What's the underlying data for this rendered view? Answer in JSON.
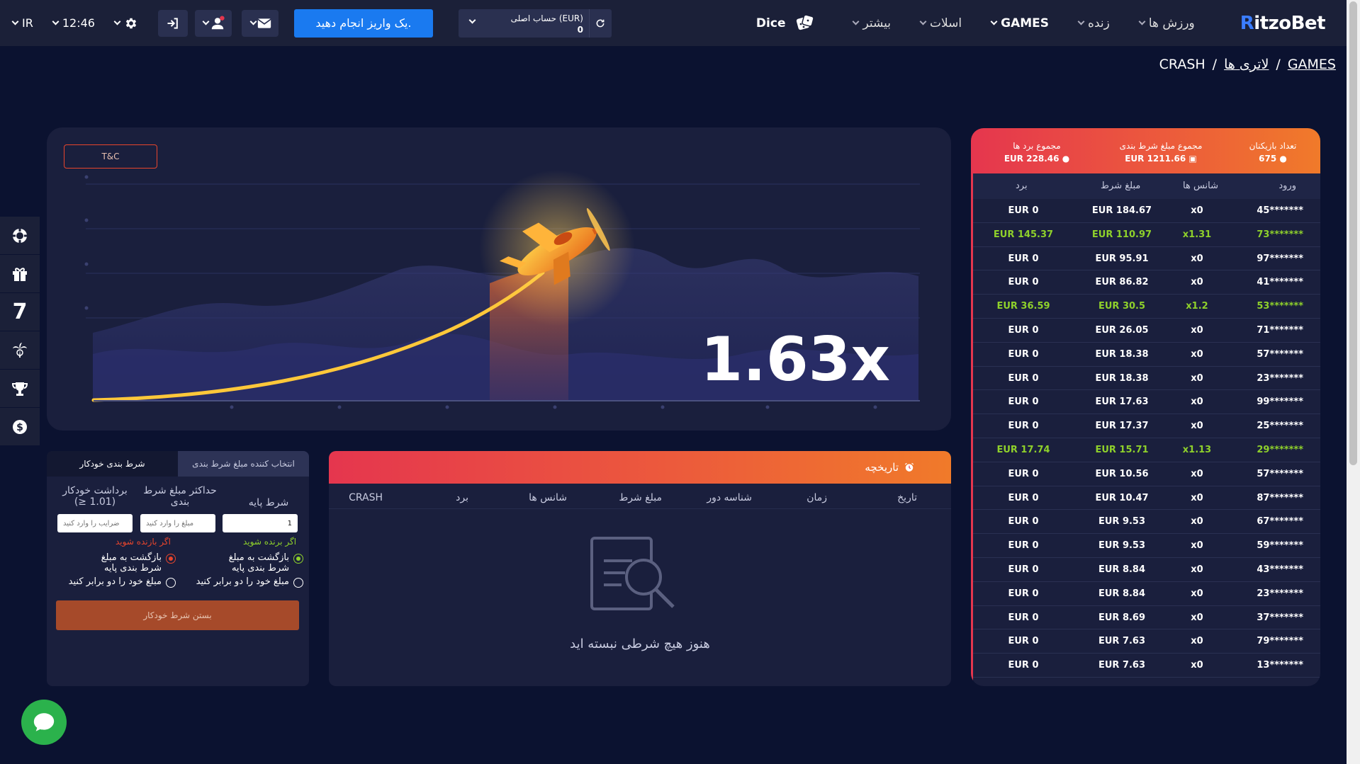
{
  "topbar": {
    "lang": "IR",
    "time": "12:46",
    "deposit_label": "یک واریز انجام دهید.",
    "account_label": "حساب اصلی (EUR)",
    "account_value": "0",
    "nav": {
      "dice": "Dice",
      "more": "بیشتر",
      "slots": "اسلات",
      "games": "GAMES",
      "live": "زنده",
      "sports": "ورزش ها"
    },
    "logo_r": "R",
    "logo_rest": "itzoBet"
  },
  "breadcrumb": {
    "games": "GAMES",
    "lotteries": "لاتری ها",
    "current": "CRASH",
    "sep": "/"
  },
  "sidebar": {
    "items": [
      "casino-chip-icon",
      "gift-icon",
      "seven",
      "palm-icon",
      "trophy-icon",
      "dollar-icon"
    ],
    "seven_label": "7"
  },
  "game": {
    "tc_label": "T&C",
    "multiplier": "1.63x",
    "multiplier_value": 1.63
  },
  "auto_bet": {
    "tab_manual": "شرط بندی خودکار",
    "tab_picker": "انتخاب کننده مبلغ شرط بندی",
    "col_base": "شرط پایه",
    "col_max": "حداکثر مبلغ شرط بندی",
    "col_cashout": "برداشت خودکار (1.01 ≤)",
    "base_value": "1",
    "max_placeholder": "مبلغ را وارد کنید",
    "cashout_placeholder": "ضرایب را وارد کنید",
    "if_win": "اگر برنده شوید",
    "if_lose": "اگر بازنده شوید",
    "return_base": "بازگشت به مبلغ شرط بندی پایه",
    "double": "مبلغ خود را دو برابر کنید",
    "submit": "بستن شرط خودکار"
  },
  "history": {
    "title": "تاریخچه",
    "columns": [
      "تاریخ",
      "زمان",
      "شناسه دور",
      "مبلغ شرط",
      "شانس ها",
      "برد",
      "CRASH"
    ],
    "empty": "هنوز هیچ شرطی نبسته اید"
  },
  "players": {
    "count_label": "تعداد بازیکنان",
    "count_value": "675",
    "total_bet_label": "مجموع مبلغ شرط بندی",
    "total_bet_value": "EUR 1211.66",
    "total_win_label": "مجموع برد ها",
    "total_win_value": "EUR 228.46",
    "columns": {
      "user": "ورود",
      "odds": "شانس ها",
      "bet": "مبلغ شرط",
      "win": "برد"
    },
    "rows": [
      {
        "user": "45*******",
        "odds": "x0",
        "bet": "EUR 184.67",
        "win": "EUR 0",
        "won": false
      },
      {
        "user": "73*******",
        "odds": "x1.31",
        "bet": "EUR 110.97",
        "win": "EUR 145.37",
        "won": true
      },
      {
        "user": "97*******",
        "odds": "x0",
        "bet": "EUR 95.91",
        "win": "EUR 0",
        "won": false
      },
      {
        "user": "41*******",
        "odds": "x0",
        "bet": "EUR 86.82",
        "win": "EUR 0",
        "won": false
      },
      {
        "user": "53*******",
        "odds": "x1.2",
        "bet": "EUR 30.5",
        "win": "EUR 36.59",
        "won": true
      },
      {
        "user": "71*******",
        "odds": "x0",
        "bet": "EUR 26.05",
        "win": "EUR 0",
        "won": false
      },
      {
        "user": "57*******",
        "odds": "x0",
        "bet": "EUR 18.38",
        "win": "EUR 0",
        "won": false
      },
      {
        "user": "23*******",
        "odds": "x0",
        "bet": "EUR 18.38",
        "win": "EUR 0",
        "won": false
      },
      {
        "user": "99*******",
        "odds": "x0",
        "bet": "EUR 17.63",
        "win": "EUR 0",
        "won": false
      },
      {
        "user": "25*******",
        "odds": "x0",
        "bet": "EUR 17.37",
        "win": "EUR 0",
        "won": false
      },
      {
        "user": "29*******",
        "odds": "x1.13",
        "bet": "EUR 15.71",
        "win": "EUR 17.74",
        "won": true
      },
      {
        "user": "57*******",
        "odds": "x0",
        "bet": "EUR 10.56",
        "win": "EUR 0",
        "won": false
      },
      {
        "user": "87*******",
        "odds": "x0",
        "bet": "EUR 10.47",
        "win": "EUR 0",
        "won": false
      },
      {
        "user": "67*******",
        "odds": "x0",
        "bet": "EUR 9.53",
        "win": "EUR 0",
        "won": false
      },
      {
        "user": "59*******",
        "odds": "x0",
        "bet": "EUR 9.53",
        "win": "EUR 0",
        "won": false
      },
      {
        "user": "43*******",
        "odds": "x0",
        "bet": "EUR 8.84",
        "win": "EUR 0",
        "won": false
      },
      {
        "user": "23*******",
        "odds": "x0",
        "bet": "EUR 8.84",
        "win": "EUR 0",
        "won": false
      },
      {
        "user": "37*******",
        "odds": "x0",
        "bet": "EUR 8.69",
        "win": "EUR 0",
        "won": false
      },
      {
        "user": "79*******",
        "odds": "x0",
        "bet": "EUR 7.63",
        "win": "EUR 0",
        "won": false
      },
      {
        "user": "13*******",
        "odds": "x0",
        "bet": "EUR 7.63",
        "win": "EUR 0",
        "won": false
      }
    ]
  },
  "colors": {
    "background": "#0b1230",
    "panel": "#1a1f3d",
    "accent_orange": "#f07a2a",
    "accent_red": "#e5364e",
    "win_green": "#8fd12b",
    "deposit_blue": "#1a7af0"
  }
}
